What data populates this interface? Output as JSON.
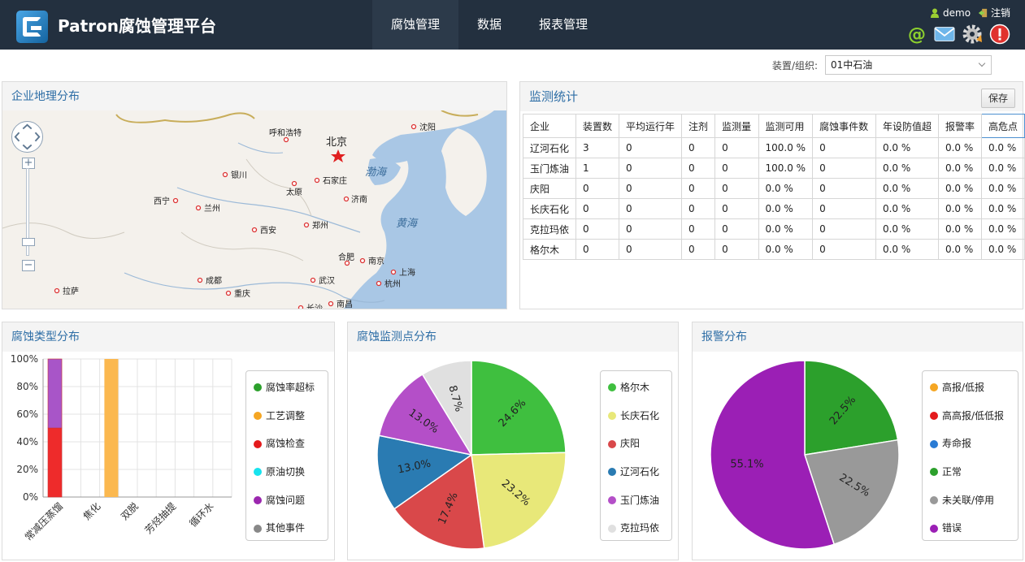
{
  "header": {
    "brand": "Patron腐蚀管理平台",
    "nav": [
      "腐蚀管理",
      "数据",
      "报表管理"
    ],
    "active_nav": 0,
    "user": "demo",
    "logout": "注销",
    "tool_icons": [
      "at-icon",
      "mail-icon",
      "gear-icon",
      "alert-icon"
    ]
  },
  "selector": {
    "label": "装置/组织:",
    "value": "01中石油"
  },
  "map_panel": {
    "title": "企业地理分布",
    "cities": [
      "北京",
      "呼和浩特",
      "沈阳",
      "银川",
      "石家庄",
      "太原",
      "济南",
      "西宁",
      "兰州",
      "西安",
      "郑州",
      "合肥",
      "南京",
      "上海",
      "成都",
      "武汉",
      "杭州",
      "重庆",
      "拉萨",
      "南昌",
      "长沙"
    ],
    "seas": [
      "渤海",
      "黄海"
    ],
    "zoom_in": "+",
    "zoom_out": "−"
  },
  "stats_panel": {
    "title": "监测统计",
    "save": "保存",
    "columns": [
      "企业",
      "装置数",
      "平均运行年",
      "注剂",
      "监测量",
      "监测可用",
      "腐蚀事件数",
      "年设防值超",
      "报警率",
      "高危点"
    ],
    "rows": [
      [
        "辽河石化",
        "3",
        "0",
        "0",
        "0",
        "100.0 %",
        "0",
        "0.0 %",
        "0.0 %",
        "0.0 %"
      ],
      [
        "玉门炼油",
        "1",
        "0",
        "0",
        "0",
        "100.0 %",
        "0",
        "0.0 %",
        "0.0 %",
        "0.0 %"
      ],
      [
        "庆阳",
        "0",
        "0",
        "0",
        "0",
        "0.0 %",
        "0",
        "0.0 %",
        "0.0 %",
        "0.0 %"
      ],
      [
        "长庆石化",
        "0",
        "0",
        "0",
        "0",
        "0.0 %",
        "0",
        "0.0 %",
        "0.0 %",
        "0.0 %"
      ],
      [
        "克拉玛依",
        "0",
        "0",
        "0",
        "0",
        "0.0 %",
        "0",
        "0.0 %",
        "0.0 %",
        "0.0 %"
      ],
      [
        "格尔木",
        "0",
        "0",
        "0",
        "0",
        "0.0 %",
        "0",
        "0.0 %",
        "0.0 %",
        "0.0 %"
      ]
    ]
  },
  "type_panel": {
    "title": "腐蚀类型分布",
    "legend": [
      {
        "label": "腐蚀率超标",
        "color": "#2ca02c"
      },
      {
        "label": "工艺调整",
        "color": "#f5a623"
      },
      {
        "label": "腐蚀检查",
        "color": "#e41a1c"
      },
      {
        "label": "原油切换",
        "color": "#17e3ee"
      },
      {
        "label": "腐蚀问题",
        "color": "#9b27af"
      },
      {
        "label": "其他事件",
        "color": "#888888"
      }
    ]
  },
  "point_panel": {
    "title": "腐蚀监测点分布",
    "legend": [
      {
        "label": "格尔木",
        "color": "#3fbf3f"
      },
      {
        "label": "长庆石化",
        "color": "#e8e879"
      },
      {
        "label": "庆阳",
        "color": "#d9484a"
      },
      {
        "label": "辽河石化",
        "color": "#2a7bb2"
      },
      {
        "label": "玉门炼油",
        "color": "#b44fc8"
      },
      {
        "label": "克拉玛依",
        "color": "#e0e0e0"
      }
    ]
  },
  "alarm_panel": {
    "title": "报警分布",
    "legend": [
      {
        "label": "高报/低报",
        "color": "#f5a623"
      },
      {
        "label": "高高报/低低报",
        "color": "#e41a1c"
      },
      {
        "label": "寿命报",
        "color": "#2a7bd4"
      },
      {
        "label": "正常",
        "color": "#2ca02c"
      },
      {
        "label": "未关联/停用",
        "color": "#999999"
      },
      {
        "label": "错误",
        "color": "#9b1fb5"
      }
    ]
  },
  "chart_data": [
    {
      "type": "bar",
      "stacked": true,
      "categories": [
        "常减压蒸馏",
        "焦化",
        "双脱",
        "芳烃抽提",
        "循环水"
      ],
      "series": [
        {
          "name": "腐蚀检查",
          "color": "#ee2b2b",
          "values": [
            50,
            0,
            0,
            0,
            0
          ]
        },
        {
          "name": "腐蚀问题",
          "color": "#a855c8",
          "values": [
            50,
            0,
            0,
            0,
            0
          ]
        },
        {
          "name": "工艺调整",
          "color": "#fbb84f",
          "values": [
            0,
            100,
            0,
            0,
            0
          ]
        }
      ],
      "ylim": [
        0,
        100
      ],
      "yticks": [
        "0%",
        "20%",
        "40%",
        "60%",
        "80%",
        "100%"
      ],
      "grid": true,
      "legend": "right"
    },
    {
      "type": "pie",
      "slices": [
        {
          "name": "格尔木",
          "value": 24.6,
          "label": "24.6%",
          "color": "#3fbf3f"
        },
        {
          "name": "长庆石化",
          "value": 23.2,
          "label": "23.2%",
          "color": "#e8e879"
        },
        {
          "name": "庆阳",
          "value": 17.4,
          "label": "17.4%",
          "color": "#d9484a"
        },
        {
          "name": "辽河石化",
          "value": 13.0,
          "label": "13.0%",
          "color": "#2a7bb2"
        },
        {
          "name": "玉门炼油",
          "value": 13.0,
          "label": "13.0%",
          "color": "#b44fc8"
        },
        {
          "name": "克拉玛依",
          "value": 8.7,
          "label": "8.7%",
          "color": "#e0e0e0"
        }
      ],
      "legend": "right"
    },
    {
      "type": "pie",
      "slices": [
        {
          "name": "正常",
          "value": 22.5,
          "label": "22.5%",
          "color": "#2ca02c"
        },
        {
          "name": "未关联/停用",
          "value": 22.5,
          "label": "22.5%",
          "color": "#999999"
        },
        {
          "name": "错误",
          "value": 55.1,
          "label": "55.1%",
          "color": "#9b1fb5"
        }
      ],
      "legend": "right"
    }
  ]
}
